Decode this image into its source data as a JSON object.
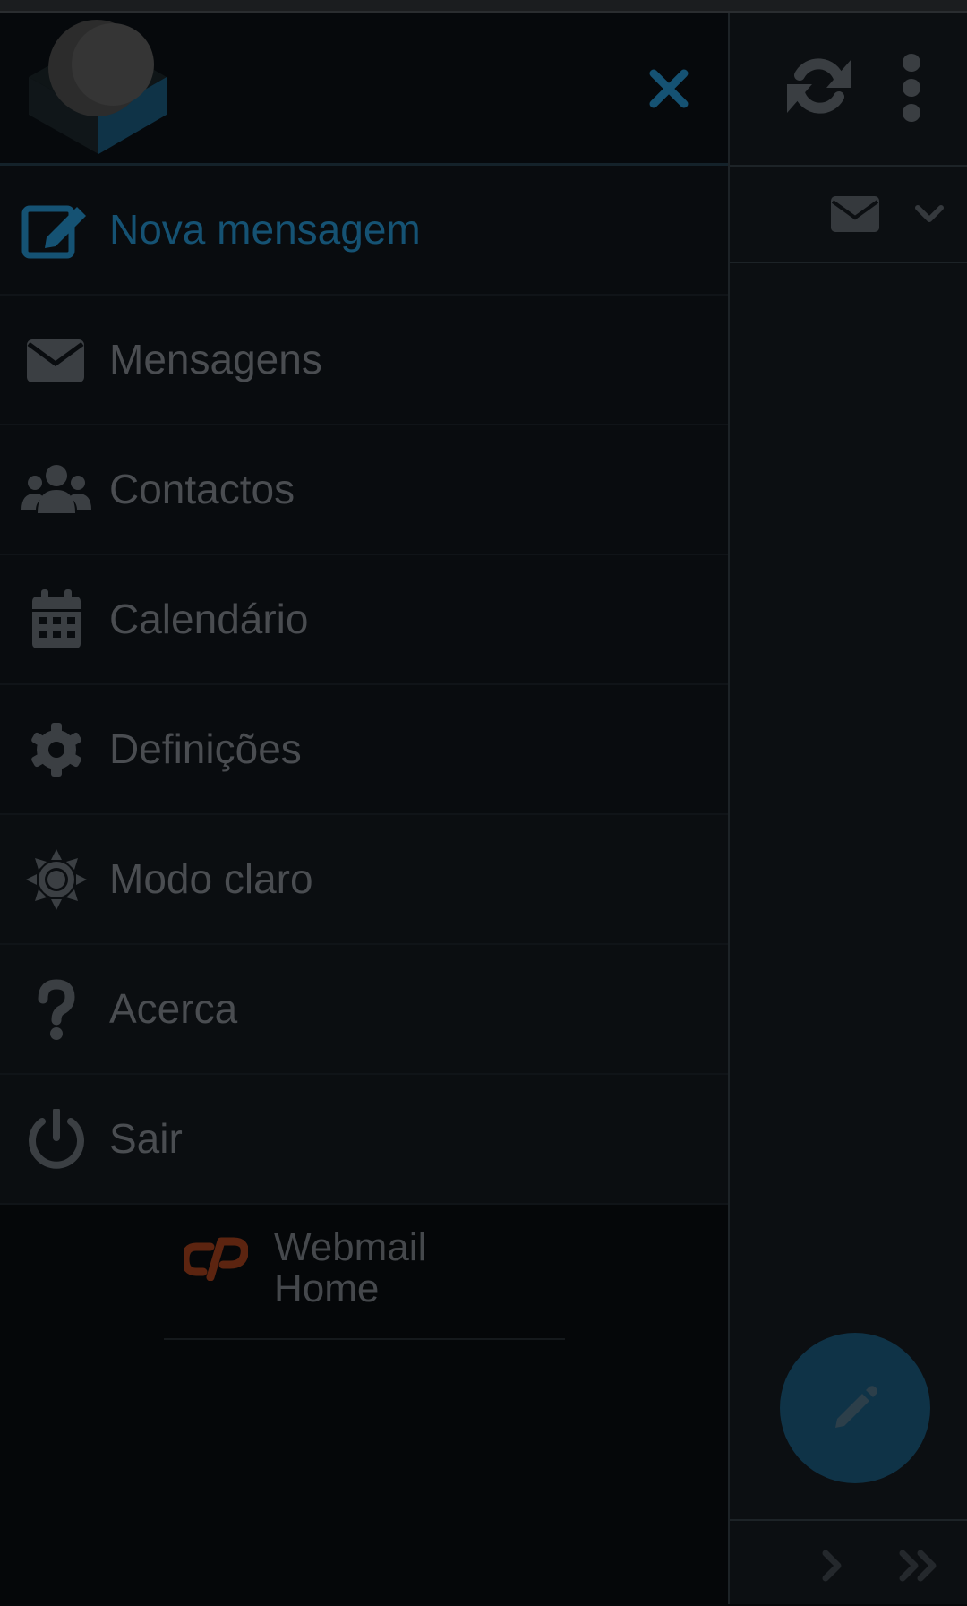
{
  "colors": {
    "accent": "#155273",
    "text_muted": "#4a4d51",
    "icon_muted": "#3b3f43",
    "cpanel": "#5c2410",
    "fab": "#0f3347"
  },
  "header": {
    "logo_icon": "roundcube-logo",
    "close_icon": "close-icon",
    "refresh_icon": "refresh-icon",
    "more_icon": "more-vertical-icon"
  },
  "menu": {
    "items": [
      {
        "label": "Nova mensagem",
        "icon": "compose-icon",
        "active": true
      },
      {
        "label": "Mensagens",
        "icon": "envelope-icon"
      },
      {
        "label": "Contactos",
        "icon": "users-icon"
      },
      {
        "label": "Calendário",
        "icon": "calendar-icon"
      },
      {
        "label": "Definições",
        "icon": "gear-icon"
      },
      {
        "label": "Modo claro",
        "icon": "sun-icon"
      },
      {
        "label": "Acerca",
        "icon": "question-icon"
      },
      {
        "label": "Sair",
        "icon": "power-icon"
      }
    ]
  },
  "webmail_home": {
    "line1": "Webmail",
    "line2": "Home",
    "icon": "cpanel-icon"
  },
  "right_pane": {
    "envelope_icon": "envelope-icon",
    "dropdown_icon": "chevron-down-icon",
    "fab_icon": "pencil-icon",
    "next_icon": "chevron-right-icon",
    "last_icon": "double-chevron-right-icon"
  }
}
